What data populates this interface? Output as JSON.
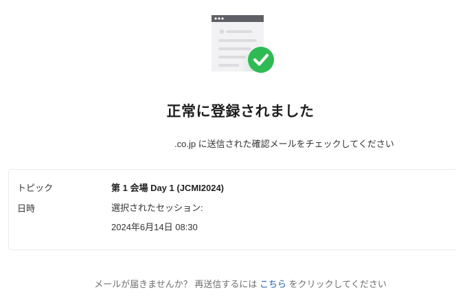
{
  "confirmation": {
    "title": "正常に登録されました",
    "subtitle": ".co.jp に送信された確認メールをチェックしてください"
  },
  "details": {
    "topic_label": "トピック",
    "topic_value": "第 1 会場 Day 1  (JCMI2024)",
    "datetime_label": "日時",
    "datetime_line1": "選択されたセッション:",
    "datetime_line2": "2024年6月14日 08:30"
  },
  "footer": {
    "prefix": "メールが届きませんか？ 再送信するには ",
    "link_text": "こちら",
    "suffix": " をクリックしてください"
  },
  "colors": {
    "success": "#2fba54",
    "link": "#1a5fb4",
    "window_header": "#5f5f66",
    "window_body": "#f2f2f4"
  },
  "icons": {
    "illustration": "browser-window-checkmark-icon"
  }
}
